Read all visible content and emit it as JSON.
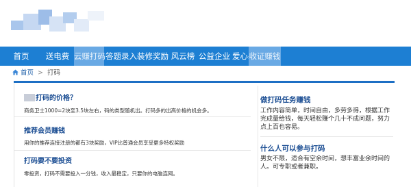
{
  "nav": {
    "items": [
      {
        "label": "首页",
        "active": false
      },
      {
        "label": "送电费",
        "active": false
      },
      {
        "label": "云赚打码",
        "active": true
      },
      {
        "label": "答题录入",
        "active": false
      },
      {
        "label": "装修奖励",
        "active": false
      },
      {
        "label": "风云榜",
        "active": false
      },
      {
        "label": "公益企业",
        "active": false
      },
      {
        "label": "爱心基地",
        "active": false
      },
      {
        "label": "收证赚钱",
        "active": true
      }
    ]
  },
  "breadcrumb": {
    "home": "首页",
    "separator": ">",
    "current": "打码"
  },
  "left": {
    "sections": [
      {
        "title": "打码的价格？",
        "text": "商务卫士1000=2块至3.5块左右，码的类型随机出。打码多的出高价格的机会多。"
      },
      {
        "title": "推荐会员赚钱",
        "text": "用你的推荐连接注册的都有3块奖励，VIP比普通会员享受更多特权奖励"
      },
      {
        "title": "打码要不要投资",
        "text": "零投资，打码不需要投入一分钱，收入最稳定，只要你的电脑连网。"
      }
    ]
  },
  "right": {
    "block1": {
      "title": "做打码任务赚钱",
      "text": "工作内容简单，时间自由，多劳多得，根据工作完成量给钱，每天轻松赚个几十不成问题，努力点上百也容易。"
    },
    "block2": {
      "title": "什么人可以参与打码",
      "text": "男女不限，适合有空余时间，想丰富业余时间的人。可专职或者兼职。"
    }
  },
  "colors": {
    "nav_bg": "#1d7fd3",
    "nav_active": "#69a9e4",
    "title_blue": "#1d4f94",
    "rule_blue": "#1d6fc4"
  },
  "icons": {
    "home": "home-icon"
  }
}
